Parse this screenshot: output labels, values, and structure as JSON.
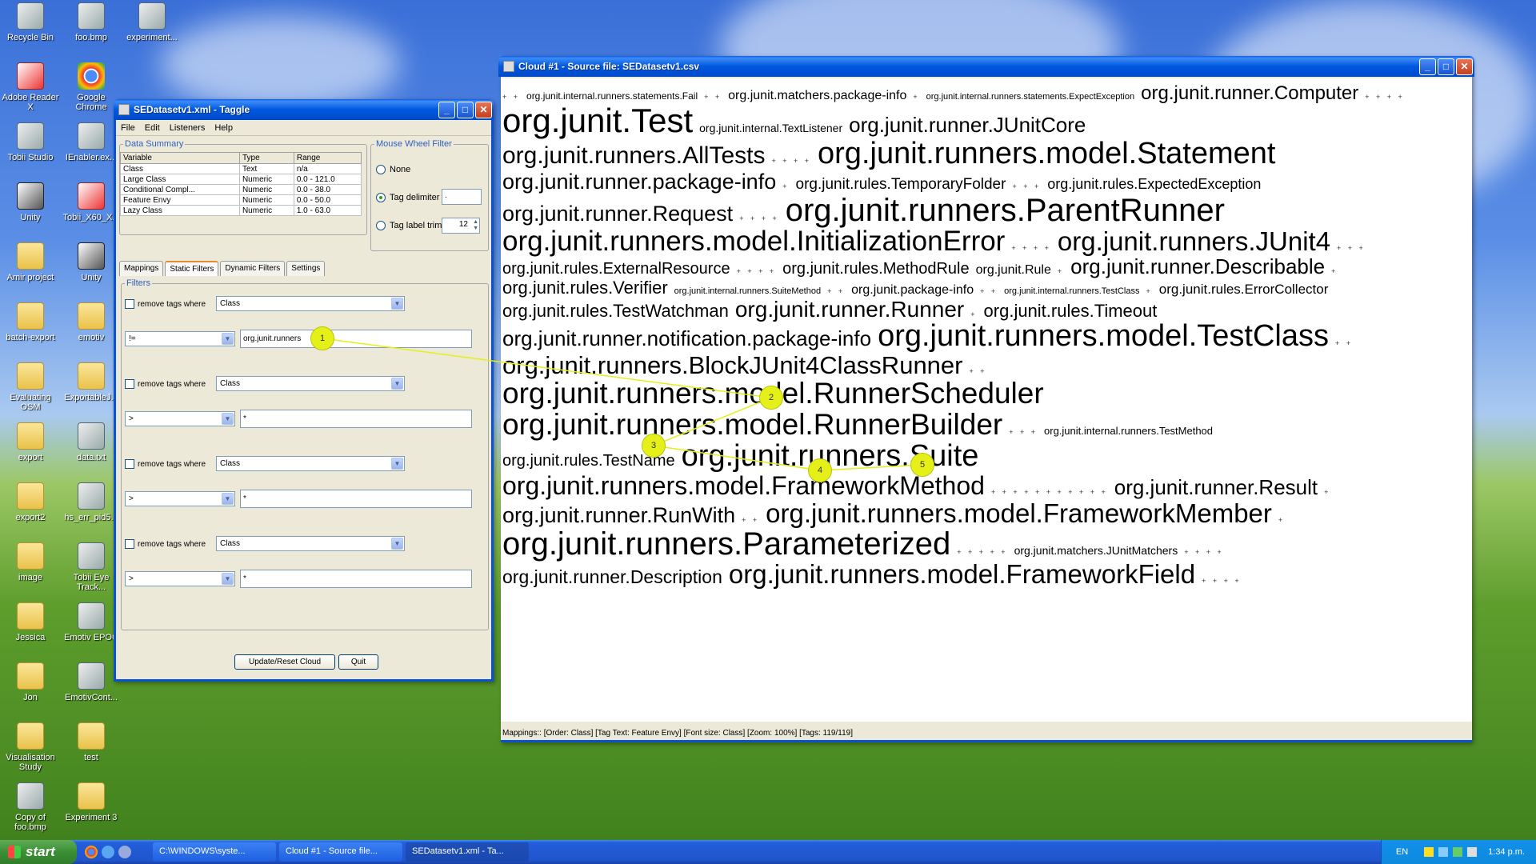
{
  "desktop": {
    "icons": [
      {
        "label": "Recycle Bin",
        "type": "app"
      },
      {
        "label": "foo.bmp",
        "type": "app"
      },
      {
        "label": "experiment...",
        "type": "app"
      },
      {
        "label": "Adobe Reader X",
        "type": "pdf"
      },
      {
        "label": "Google Chrome",
        "type": "chrome"
      },
      {
        "label": "Tobii Studio",
        "type": "app"
      },
      {
        "label": "IEnabler.ex...",
        "type": "app"
      },
      {
        "label": "Unity",
        "type": "unity"
      },
      {
        "label": "Tobii_X60_X...",
        "type": "pdf"
      },
      {
        "label": "Amir project",
        "type": "folder"
      },
      {
        "label": "Unity",
        "type": "unity"
      },
      {
        "label": "batch-export",
        "type": "folder"
      },
      {
        "label": "emotiv",
        "type": "folder"
      },
      {
        "label": "Evaluating OSM",
        "type": "folder"
      },
      {
        "label": "ExportableJ...",
        "type": "folder"
      },
      {
        "label": "export",
        "type": "folder"
      },
      {
        "label": "data.txt",
        "type": "app"
      },
      {
        "label": "export2",
        "type": "folder"
      },
      {
        "label": "hs_err_pid5...",
        "type": "app"
      },
      {
        "label": "image",
        "type": "folder"
      },
      {
        "label": "Tobii Eye Track...",
        "type": "app"
      },
      {
        "label": "Jessica",
        "type": "folder"
      },
      {
        "label": "Emotiv EPOC",
        "type": "app"
      },
      {
        "label": "Jon",
        "type": "folder"
      },
      {
        "label": "EmotivCont...",
        "type": "app"
      },
      {
        "label": "Visualisation Study",
        "type": "folder"
      },
      {
        "label": "test",
        "type": "folder"
      },
      {
        "label": "Copy of foo.bmp",
        "type": "app"
      },
      {
        "label": "Experiment 3",
        "type": "folder"
      }
    ]
  },
  "taggle": {
    "title": "SEDatasetv1.xml - Taggle",
    "menu": [
      "File",
      "Edit",
      "Listeners",
      "Help"
    ],
    "data_summary": {
      "legend": "Data Summary",
      "headers": [
        "Variable",
        "Type",
        "Range"
      ],
      "rows": [
        [
          "Class",
          "Text",
          "n/a"
        ],
        [
          "Large Class",
          "Numeric",
          "0.0 - 121.0"
        ],
        [
          "Conditional Compl...",
          "Numeric",
          "0.0 - 38.0"
        ],
        [
          "Feature Envy",
          "Numeric",
          "0.0 - 50.0"
        ],
        [
          "Lazy Class",
          "Numeric",
          "1.0 - 63.0"
        ]
      ]
    },
    "mouse_wheel": {
      "legend": "Mouse Wheel Filter",
      "none": "None",
      "tag_delimiter": "Tag delimiter",
      "tag_delimiter_value": ".",
      "tag_label_trim": "Tag label trim",
      "trim_value": "12",
      "selected": "tag_delimiter"
    },
    "tabs": [
      "Mappings",
      "Static Filters",
      "Dynamic Filters",
      "Settings"
    ],
    "active_tab": "Static Filters",
    "filters_legend": "Filters",
    "filters": [
      {
        "label": "remove tags where",
        "field": "Class",
        "op": "!=",
        "value": "org.junit.runners"
      },
      {
        "label": "remove tags where",
        "field": "Class",
        "op": ">",
        "value": "*"
      },
      {
        "label": "remove tags where",
        "field": "Class",
        "op": ">",
        "value": "*"
      },
      {
        "label": "remove tags where",
        "field": "Class",
        "op": ">",
        "value": "*"
      }
    ],
    "buttons": {
      "update": "Update/Reset Cloud",
      "quit": "Quit"
    }
  },
  "cloud": {
    "title": "Cloud #1 - Source file: SEDatasetv1.csv",
    "lines": [
      [
        {
          "d": "+ +"
        },
        {
          "t": "org.junit.internal.runners.statements.Fail",
          "s": 12
        },
        {
          "d": "+ +"
        },
        {
          "t": "org.junit.matchers.package-info",
          "s": 16
        },
        {
          "d": "+"
        },
        {
          "t": "org.junit.internal.runners.statements.ExpectException",
          "s": 11
        },
        {
          "t": "org.junit.runner.Computer",
          "s": 24
        },
        {
          "d": "+ + + +"
        }
      ],
      [
        {
          "t": "org.junit.Test",
          "s": 42
        },
        {
          "t": "org.junit.internal.TextListener",
          "s": 14
        },
        {
          "t": "org.junit.runner.JUnitCore",
          "s": 26
        }
      ],
      [
        {
          "t": "org.junit.runners.AllTests",
          "s": 30
        },
        {
          "d": "+ + + +"
        },
        {
          "t": "org.junit.runners.model.Statement",
          "s": 38
        }
      ],
      [
        {
          "t": "org.junit.runner.package-info",
          "s": 27
        },
        {
          "d": "+"
        },
        {
          "t": "org.junit.rules.TemporaryFolder",
          "s": 19
        },
        {
          "d": "+ + +"
        },
        {
          "t": "org.junit.rules.ExpectedException",
          "s": 18
        }
      ],
      [
        {
          "t": "org.junit.runner.Request",
          "s": 27
        },
        {
          "d": "+ + + +"
        },
        {
          "t": "org.junit.runners.ParentRunner",
          "s": 40
        }
      ],
      [
        {
          "t": "org.junit.runners.model.InitializationError",
          "s": 35
        },
        {
          "d": "+ + + +"
        },
        {
          "t": "org.junit.runners.JUnit4",
          "s": 33
        },
        {
          "d": "+ + +"
        }
      ],
      [
        {
          "t": "org.junit.rules.ExternalResource",
          "s": 20
        },
        {
          "d": "+ + + +"
        },
        {
          "t": "org.junit.rules.MethodRule",
          "s": 20
        },
        {
          "t": "org.junit.Rule",
          "s": 16
        },
        {
          "d": "+"
        },
        {
          "t": "org.junit.runner.Describable",
          "s": 26
        },
        {
          "d": "+"
        }
      ],
      [
        {
          "t": "org.junit.rules.Verifier",
          "s": 22
        },
        {
          "t": "org.junit.internal.runners.SuiteMethod",
          "s": 11
        },
        {
          "d": "+ +"
        },
        {
          "t": "org.junit.package-info",
          "s": 16
        },
        {
          "d": "+ +"
        },
        {
          "t": "org.junit.internal.runners.TestClass",
          "s": 11
        },
        {
          "d": "+"
        },
        {
          "t": "org.junit.rules.ErrorCollector",
          "s": 17
        }
      ],
      [
        {
          "t": "org.junit.rules.TestWatchman",
          "s": 22
        },
        {
          "t": "org.junit.runner.Runner",
          "s": 28
        },
        {
          "d": "+"
        },
        {
          "t": "org.junit.rules.Timeout",
          "s": 22
        }
      ],
      [
        {
          "t": "org.junit.runner.notification.package-info",
          "s": 26
        },
        {
          "t": "org.junit.runners.model.TestClass",
          "s": 38
        },
        {
          "d": "+ +"
        }
      ],
      [
        {
          "t": "org.junit.runners.BlockJUnit4ClassRunner",
          "s": 31
        },
        {
          "d": "+ +"
        }
      ],
      [
        {
          "t": "org.junit.runners.model.RunnerScheduler",
          "s": 37
        }
      ],
      [
        {
          "t": "org.junit.runners.model.RunnerBuilder",
          "s": 37
        },
        {
          "d": "+ + +"
        },
        {
          "t": "org.junit.internal.runners.TestMethod",
          "s": 13
        }
      ],
      [
        {
          "t": "org.junit.rules.TestName",
          "s": 20
        },
        {
          "t": "org.junit.runners.Suite",
          "s": 38
        }
      ],
      [
        {
          "t": "org.junit.runners.model.FrameworkMethod",
          "s": 32
        },
        {
          "d": "+ + + + + + + + + + +"
        },
        {
          "t": "org.junit.runner.Result",
          "s": 26
        },
        {
          "d": "+"
        }
      ],
      [
        {
          "t": "org.junit.runner.RunWith",
          "s": 27
        },
        {
          "d": "+ +"
        },
        {
          "t": "org.junit.runners.model.FrameworkMember",
          "s": 33
        },
        {
          "d": "+"
        }
      ],
      [
        {
          "t": "org.junit.runners.Parameterized",
          "s": 40
        },
        {
          "d": "+ + + + +"
        },
        {
          "t": "org.junit.matchers.JUnitMatchers",
          "s": 14
        },
        {
          "d": "+ + + +"
        }
      ],
      [
        {
          "t": "org.junit.runner.Description",
          "s": 23
        },
        {
          "t": "org.junit.runners.model.FrameworkField",
          "s": 33
        },
        {
          "d": "+ + + +"
        }
      ]
    ],
    "status": "Mappings:: [Order: Class] [Tag Text: Feature Envy] [Font size: Class] [Zoom: 100%] [Tags: 119/119]"
  },
  "gaze_points": [
    "1",
    "2",
    "3",
    "4",
    "5"
  ],
  "taskbar": {
    "start": "start",
    "tasks": [
      "C:\\WINDOWS\\syste...",
      "Cloud #1 - Source file...",
      "SEDatasetv1.xml - Ta..."
    ],
    "lang": "EN",
    "clock": "1:34 p.m."
  }
}
